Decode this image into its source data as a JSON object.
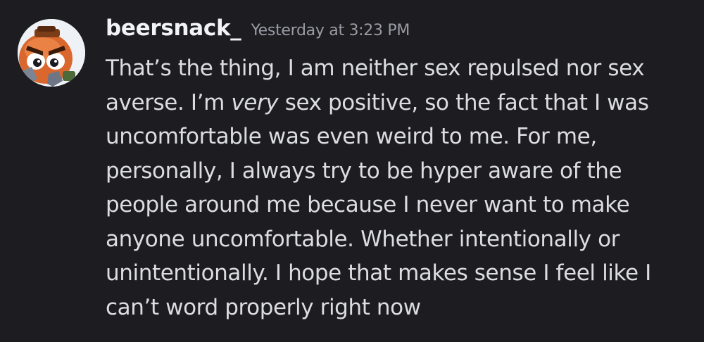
{
  "message": {
    "author": "beersnack_",
    "timestamp": "Yesterday at 3:23 PM",
    "avatar_icon": "bomb-character-avatar",
    "lines": [
      {
        "pre": "That’s the thing, I am neither sex repulsed nor sex",
        "em": "",
        "post": ""
      },
      {
        "pre": "averse. I’m ",
        "em": "very",
        "post": " sex positive, so the fact that I was"
      },
      {
        "pre": "uncomfortable was even weird to me. For me,",
        "em": "",
        "post": ""
      },
      {
        "pre": "personally, I always try to be hyper aware of the",
        "em": "",
        "post": ""
      },
      {
        "pre": "people around me because I never want to make",
        "em": "",
        "post": ""
      },
      {
        "pre": "anyone uncomfortable. Whether intentionally or",
        "em": "",
        "post": ""
      },
      {
        "pre": "unintentionally. I hope that makes sense I feel like I",
        "em": "",
        "post": ""
      },
      {
        "pre": "can’t word properly right now",
        "em": "",
        "post": ""
      }
    ]
  },
  "colors": {
    "background": "#1c1c21",
    "username": "#f2f3f5",
    "timestamp": "#9a9ba3",
    "text": "#dcdde1"
  }
}
